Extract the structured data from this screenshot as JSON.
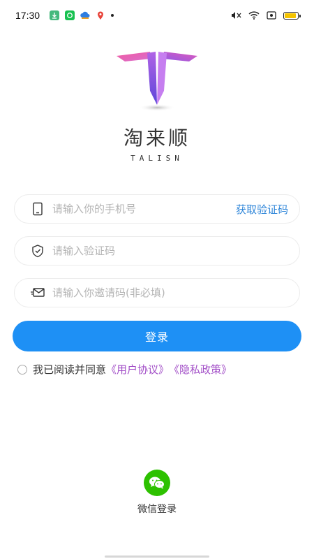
{
  "status_bar": {
    "time": "17:30",
    "notification_icons": [
      "download-icon",
      "chat-bubble-icon",
      "cloud-icon",
      "map-pin-icon"
    ],
    "right_icons": [
      "mute-icon",
      "wifi-icon",
      "screen-record-icon",
      "battery-icon"
    ],
    "battery_level": 0.9
  },
  "brand": {
    "name": "淘来顺",
    "subtitle": "TALISN",
    "logo_colors": [
      "#f25aa0",
      "#7b52e6"
    ]
  },
  "form": {
    "phone": {
      "placeholder": "请输入你的手机号",
      "value": "",
      "icon": "phone-icon"
    },
    "get_code_label": "获取验证码",
    "code": {
      "placeholder": "请输入验证码",
      "value": "",
      "icon": "shield-check-icon"
    },
    "invite": {
      "placeholder": "请输入你邀请码(非必填)",
      "value": "",
      "icon": "mail-icon"
    },
    "login_label": "登录"
  },
  "agreement": {
    "prefix": "我已阅读并同意",
    "user_agreement": "《用户协议》",
    "privacy_policy": "《隐私政策》",
    "checked": false
  },
  "wechat": {
    "label": "微信登录",
    "icon": "wechat-icon"
  },
  "colors": {
    "accent": "#1e90f5",
    "link": "#2f86d9",
    "policy_link": "#a24ec7",
    "wechat_green": "#2dc100"
  }
}
